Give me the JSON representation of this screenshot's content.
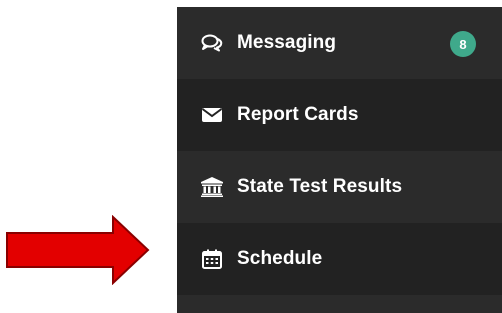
{
  "menu": {
    "items": [
      {
        "label": "Messaging",
        "icon": "chat-bubbles-icon",
        "badge": "8"
      },
      {
        "label": "Report Cards",
        "icon": "envelope-icon"
      },
      {
        "label": "State Test Results",
        "icon": "institution-icon"
      },
      {
        "label": "Schedule",
        "icon": "calendar-icon"
      }
    ]
  },
  "colors": {
    "arrow": "#e30000",
    "menu_background": "#2b2b2b",
    "menu_background_alt": "#222222",
    "badge": "#3fa98b",
    "text": "#ffffff"
  }
}
